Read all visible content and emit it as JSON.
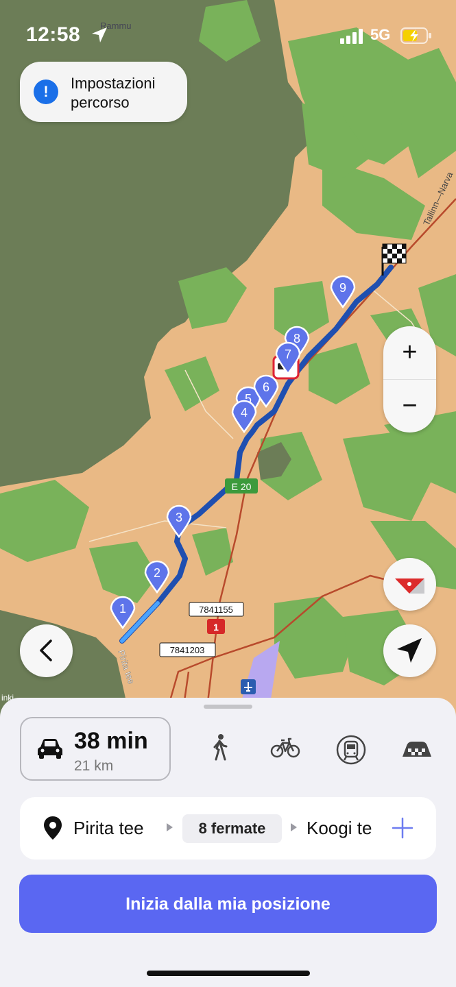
{
  "status_bar": {
    "time": "12:58",
    "network": "5G"
  },
  "map": {
    "place_labels": {
      "rammu": "Rammu",
      "tallinn_narva": "Tallinn—Narva",
      "pirita_tee": "Pirita tee",
      "helsinki_partial": "inki"
    },
    "road_badges": {
      "e20": "E 20",
      "r1": "1",
      "r7841155": "7841155",
      "r7841203": "7841203"
    },
    "waypoints": [
      "1",
      "2",
      "3",
      "4",
      "5",
      "6",
      "7",
      "8",
      "9"
    ]
  },
  "route_settings": {
    "label": "Impostazioni percorso",
    "icon": "exclamation-icon"
  },
  "zoom": {
    "in": "+",
    "out": "−"
  },
  "travel": {
    "duration": "38 min",
    "distance": "21 km"
  },
  "modes": [
    "car-icon",
    "walk-icon",
    "bike-icon",
    "transit-icon",
    "taxi-icon"
  ],
  "route": {
    "from": "Pirita tee",
    "stops": "8 fermate",
    "to": "Koogi te"
  },
  "start_button": "Inizia dalla mia posizione",
  "colors": {
    "accent": "#5a67f2",
    "route": "#1f4fb0",
    "pin": "#5e74ea",
    "water": "#6e7f58",
    "land": "#e9b985",
    "forest": "#79b25a"
  }
}
